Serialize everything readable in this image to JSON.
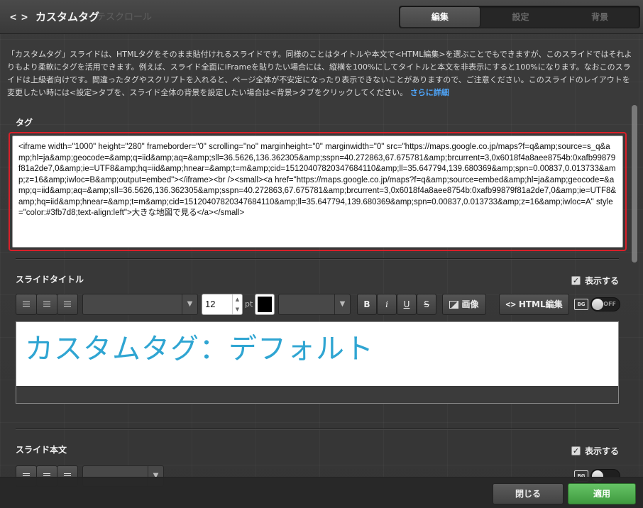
{
  "header": {
    "title": "カスタムタグ",
    "ghost_text": "テスクロール",
    "tabs": [
      {
        "label": "編集",
        "active": true
      },
      {
        "label": "設定",
        "active": false
      },
      {
        "label": "背景",
        "active": false
      }
    ]
  },
  "description": {
    "text": "「カスタムタグ」スライドは、HTMLタグをそのまま貼付けれるスライドです。同様のことはタイトルや本文で<HTML編集>を選ぶことでもできますが、このスライドではそれよりもより柔軟にタグを活用できます。例えば、スライド全面にiFrameを貼りたい場合には、縦横を100%にしてタイトルと本文を非表示にすると100%になります。なおこのスライドは上級者向けです。間違ったタグやスクリプトを入れると、ページ全体が不安定になったり表示できないことがありますので、ご注意ください。このスライドのレイアウトを変更したい時には<設定>タブを、スライド全体の背景を設定したい場合は<背景>タブをクリックしてください。",
    "link": "さらに詳細"
  },
  "tag_section": {
    "label": "タグ",
    "value": "<iframe width=\"1000\" height=\"280\" frameborder=\"0\" scrolling=\"no\" marginheight=\"0\" marginwidth=\"0\" src=\"https://maps.google.co.jp/maps?f=q&amp;source=s_q&amp;hl=ja&amp;geocode=&amp;q=iid&amp;aq=&amp;sll=36.5626,136.362305&amp;sspn=40.272863,67.675781&amp;brcurrent=3,0x6018f4a8aee8754b:0xafb99879f81a2de7,0&amp;ie=UTF8&amp;hq=iid&amp;hnear=&amp;t=m&amp;cid=15120407820347684110&amp;ll=35.647794,139.680369&amp;spn=0.00837,0.013733&amp;z=16&amp;iwloc=B&amp;output=embed\"></iframe><br /><small><a href=\"https://maps.google.co.jp/maps?f=q&amp;source=embed&amp;hl=ja&amp;geocode=&amp;q=iid&amp;aq=&amp;sll=36.5626,136.362305&amp;sspn=40.272863,67.675781&amp;brcurrent=3,0x6018f4a8aee8754b:0xafb99879f81a2de7,0&amp;ie=UTF8&amp;hq=iid&amp;hnear=&amp;t=m&amp;cid=15120407820347684110&amp;ll=35.647794,139.680369&amp;spn=0.00837,0.013733&amp;z=16&amp;iwloc=A\" style=\"color:#3fb7d8;text-align:left\">大きな地図で見る</a></small>"
  },
  "slide_title": {
    "label": "スライドタイトル",
    "show_label": "表示する",
    "show_checked": true,
    "font_size": "12",
    "unit": "pt",
    "color": "#000000",
    "bold": "B",
    "italic": "i",
    "underline": "U",
    "strike": "S",
    "image_button": "画像",
    "html_edit_button": "HTML編集",
    "bg_badge": "BG",
    "toggle_label": "OFF",
    "preview_text": "カスタムタグ：デフォルト"
  },
  "slide_body": {
    "label": "スライド本文",
    "show_label": "表示する",
    "show_checked": true,
    "bg_badge": "BG"
  },
  "footer": {
    "close_label": "閉じる",
    "apply_label": "適用"
  }
}
